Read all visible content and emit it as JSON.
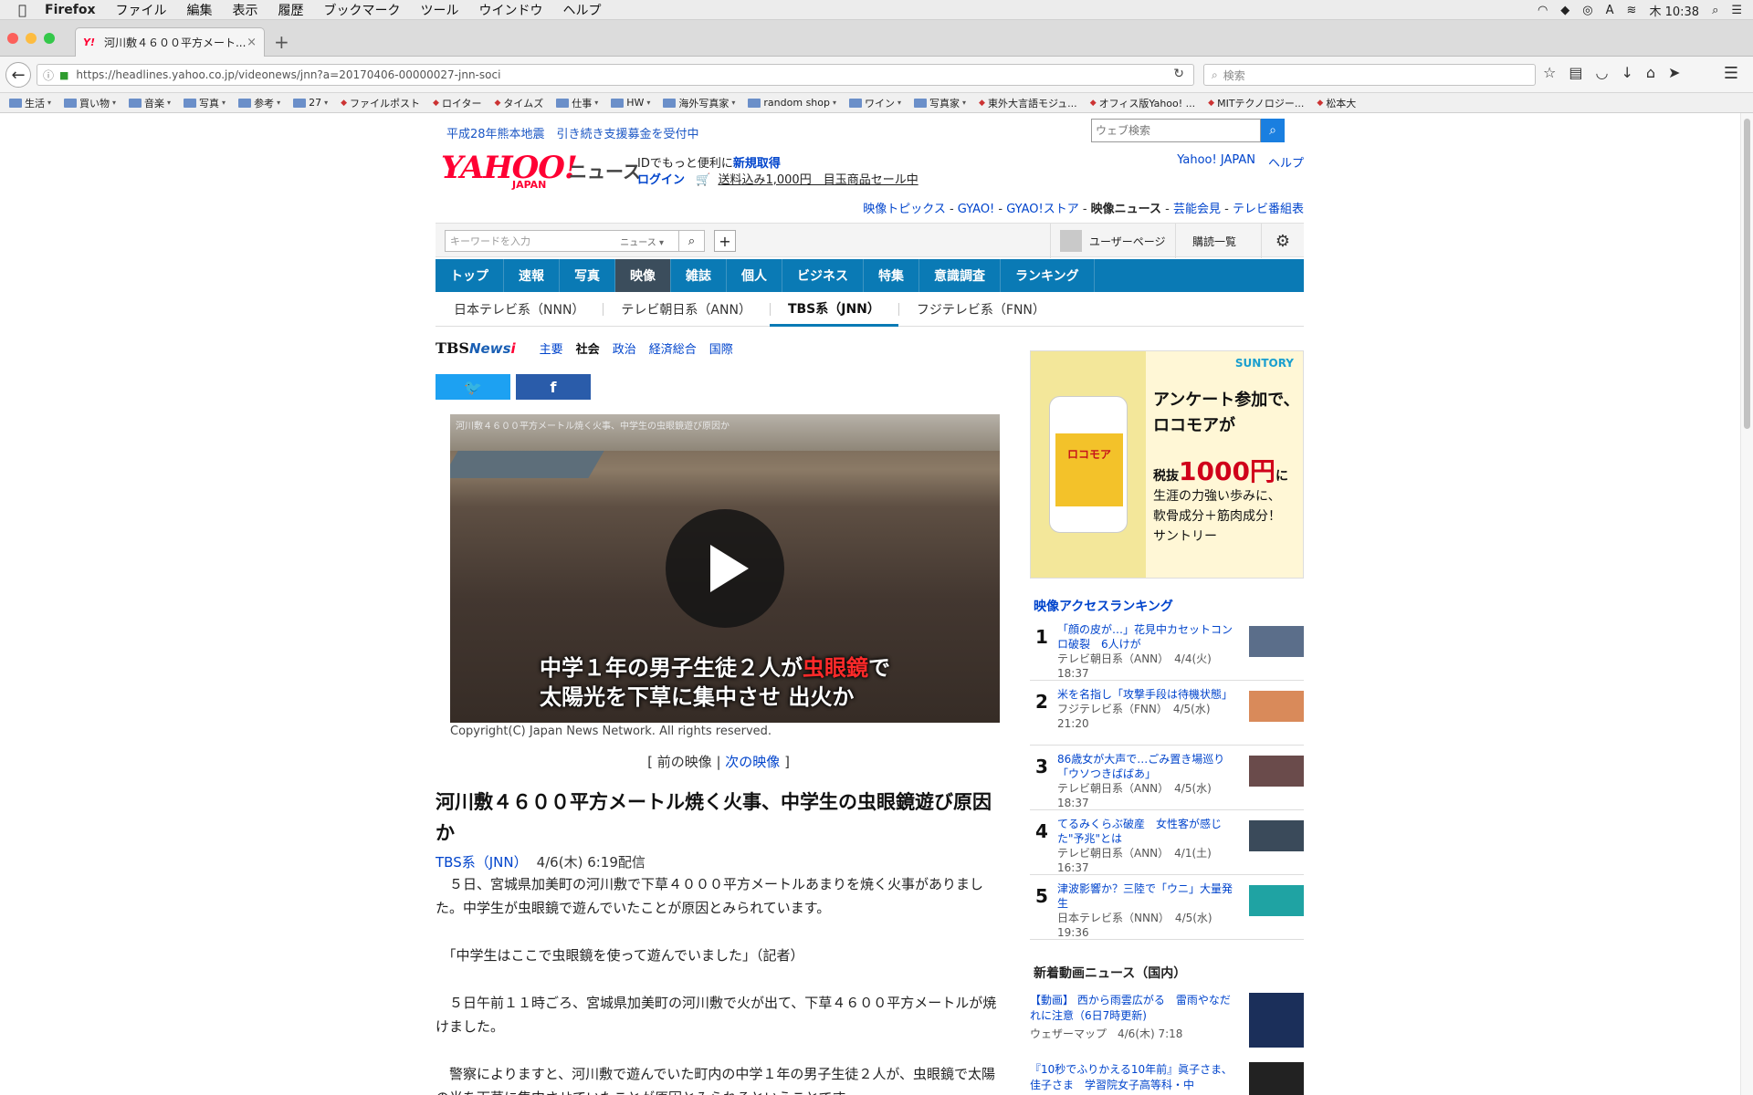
{
  "menubar": {
    "app": "Firefox",
    "items": [
      "ファイル",
      "編集",
      "表示",
      "履歴",
      "ブックマーク",
      "ツール",
      "ウインドウ",
      "ヘルプ"
    ],
    "clock": "木 10:38"
  },
  "tab": {
    "title": "河川敷４６００平方メート...",
    "favicon": "Y!"
  },
  "url": "https://headlines.yahoo.co.jp/videonews/jnn?a=20170406-00000027-jnn-soci",
  "search_placeholder": "検索",
  "bookmarks": [
    {
      "label": "生活",
      "folder": true
    },
    {
      "label": "買い物",
      "folder": true
    },
    {
      "label": "音楽",
      "folder": true
    },
    {
      "label": "写真",
      "folder": true
    },
    {
      "label": "参考",
      "folder": true
    },
    {
      "label": "27",
      "folder": true
    },
    {
      "label": "ファイルポスト",
      "folder": false
    },
    {
      "label": "ロイター",
      "folder": false
    },
    {
      "label": "タイムズ",
      "folder": false
    },
    {
      "label": "仕事",
      "folder": true
    },
    {
      "label": "HW",
      "folder": true
    },
    {
      "label": "海外写真家",
      "folder": true
    },
    {
      "label": "random shop",
      "folder": true
    },
    {
      "label": "ワイン",
      "folder": true
    },
    {
      "label": "写真家",
      "folder": true
    },
    {
      "label": "東外大言語モジュ...",
      "folder": false
    },
    {
      "label": "オフィス版Yahoo! ...",
      "folder": false
    },
    {
      "label": "MITテクノロジー...",
      "folder": false
    },
    {
      "label": "松本大",
      "folder": false
    }
  ],
  "site": {
    "topline": "平成28年熊本地震　引き続き支援募金を受付中",
    "websearch_placeholder": "ウェブ検索",
    "logo": "YAHOO!",
    "logo_sub": "JAPAN",
    "logo_news": "ニュース",
    "id_text": "IDでもっと便利に",
    "id_link": "新規取得",
    "login": "ログイン",
    "promo": "送料込み1,000円　目玉商品セール中",
    "header_links": [
      "Yahoo! JAPAN",
      "ヘルプ"
    ],
    "sublinks": [
      "映像トピックス",
      "GYAO!",
      "GYAO!ストア",
      "映像ニュース",
      "芸能会見",
      "テレビ番組表"
    ],
    "keyword_placeholder": "キーワードを入力",
    "keyword_scope": "ニュース",
    "user_page": "ユーザーページ",
    "subscriptions": "購読一覧",
    "global_nav": [
      "トップ",
      "速報",
      "写真",
      "映像",
      "雑誌",
      "個人",
      "ビジネス",
      "特集",
      "意識調査",
      "ランキング"
    ],
    "global_nav_active": "映像",
    "broadcaster_nav": [
      "日本テレビ系（NNN）",
      "テレビ朝日系（ANN）",
      "TBS系（JNN）",
      "フジテレビ系（FNN）"
    ],
    "broadcaster_active": "TBS系（JNN）",
    "tbs_logo": "TBS",
    "tbs_logo_news": "News",
    "tbs_logo_i": "i",
    "tbs_categories": [
      "主要",
      "社会",
      "政治",
      "経済総合",
      "国際"
    ],
    "tbs_category_active": "社会"
  },
  "article": {
    "video_title": "河川敷４６００平方メートル焼く火事、中学生の虫眼鏡遊び原因か",
    "caption_line1_a": "中学１年の男子生徒２人が",
    "caption_line1_red": "虫眼鏡",
    "caption_line1_b": "で",
    "caption_line2": "太陽光を下草に集中させ 出火か",
    "copyright": "Copyright(C) Japan News Network. All rights reserved.",
    "prev": "前の映像",
    "next": "次の映像",
    "headline": "河川敷４６００平方メートル焼く火事、中学生の虫眼鏡遊び原因か",
    "source": "TBS系（JNN）",
    "date": "4/6(木) 6:19配信",
    "paragraphs": [
      "　５日、宮城県加美町の河川敷で下草４０００平方メートルあまりを焼く火事がありました。中学生が虫眼鏡で遊んでいたことが原因とみられています。",
      "　「中学生はここで虫眼鏡を使って遊んでいました」（記者）",
      "　５日午前１１時ごろ、宮城県加美町の河川敷で火が出て、下草４６００平方メートルが焼けました。",
      "　警察によりますと、河川敷で遊んでいた町内の中学１年の男子生徒２人が、虫眼鏡で太陽の光を下草に集中させていたことが原因とみられるということです。"
    ]
  },
  "ad": {
    "brand": "SUNTORY",
    "product": "ロコモア",
    "line1": "アンケート参加で、",
    "line2": "ロコモアが",
    "price_prefix": "税抜",
    "price": "1000円",
    "price_suffix": "に",
    "line3": "生涯の力強い歩みに、",
    "line4": "軟骨成分＋筋肉成分！",
    "line5": "サントリー"
  },
  "ranking": {
    "heading": "映像アクセスランキング",
    "items": [
      {
        "rank": "1",
        "title": "「顔の皮が…」花見中カセットコンロ破裂　6人けが",
        "source": "テレビ朝日系（ANN）　4/4(火) 18:37"
      },
      {
        "rank": "2",
        "title": "米を名指し「攻撃手段は待機状態」",
        "source": "フジテレビ系（FNN）　4/5(水) 21:20"
      },
      {
        "rank": "3",
        "title": "86歳女が大声で…ごみ置き場巡り「ウソつきばばあ」",
        "source": "テレビ朝日系（ANN）　4/5(水) 18:37"
      },
      {
        "rank": "4",
        "title": "てるみくらぶ破産　女性客が感じた\"予兆\"とは",
        "source": "テレビ朝日系（ANN）　4/1(土) 16:37"
      },
      {
        "rank": "5",
        "title": "津波影響か？三陸で「ウニ」大量発生",
        "source": "日本テレビ系（NNN）　4/5(水) 19:36"
      }
    ]
  },
  "newvideos": {
    "heading": "新着動画ニュース（国内）",
    "items": [
      {
        "title": "【動画】 西から雨雲広がる　雷雨やなだれに注意（6日7時更新)",
        "source": "ウェザーマップ　4/6(木) 7:18"
      },
      {
        "title": "『10秒でふりかえる10年前』眞子さま、佳子さま　学習院女子高等科・中",
        "source": ""
      }
    ]
  }
}
